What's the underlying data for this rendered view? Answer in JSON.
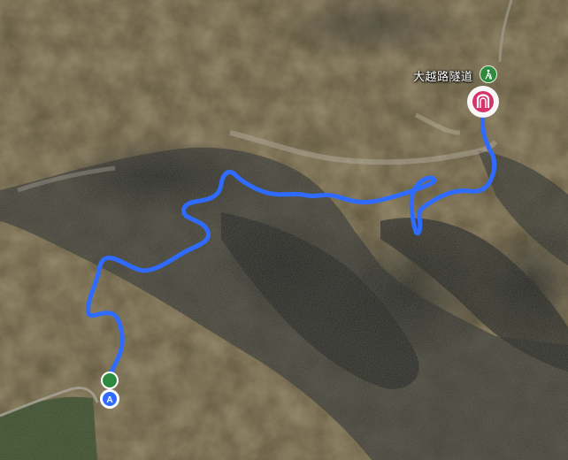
{
  "map": {
    "type": "satellite",
    "landmarks": [
      {
        "label": "大越路隧道",
        "icon": "hiking-person-icon",
        "marker_icon": "tunnel-icon"
      }
    ],
    "markers": [
      {
        "label": "A",
        "icon": "start-flag-icon"
      }
    ],
    "route": {
      "color": "#2f6bff"
    }
  }
}
